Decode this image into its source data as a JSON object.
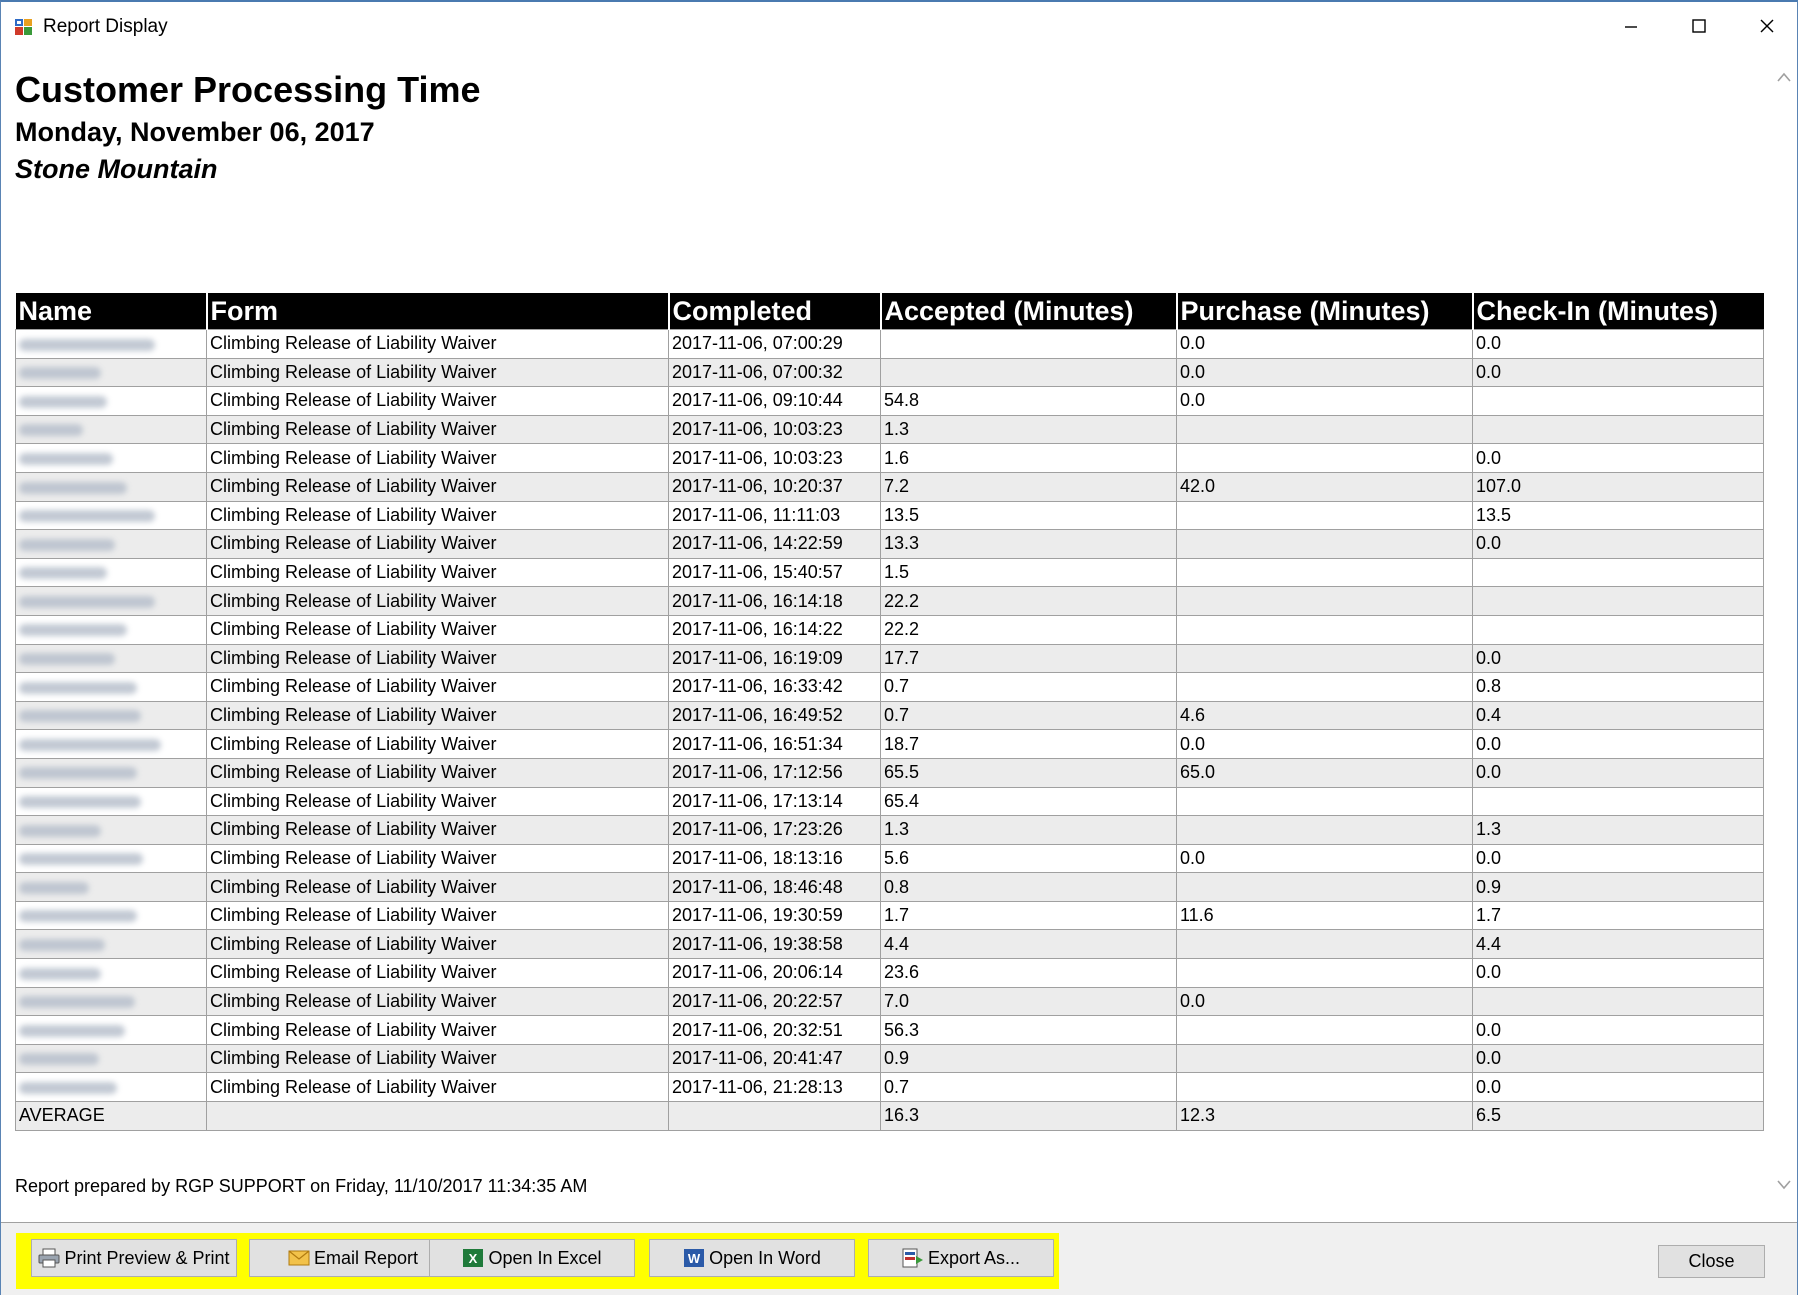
{
  "window": {
    "title": "Report Display",
    "app_icon": "report-app-icon",
    "controls": [
      "minimize-icon",
      "maximize-icon",
      "close-icon"
    ]
  },
  "report": {
    "title": "Customer Processing Time",
    "date": "Monday, November 06, 2017",
    "location": "Stone Mountain",
    "columns": [
      "Name",
      "Form",
      "Completed",
      "Accepted (Minutes)",
      "Purchase (Minutes)",
      "Check-In (Minutes)"
    ],
    "rows": [
      {
        "form": "Climbing Release of Liability Waiver",
        "completed": "2017-11-06, 07:00:29",
        "accepted": "",
        "purchase": "0.0",
        "checkin": "0.0"
      },
      {
        "form": "Climbing Release of Liability Waiver",
        "completed": "2017-11-06, 07:00:32",
        "accepted": "",
        "purchase": "0.0",
        "checkin": "0.0"
      },
      {
        "form": "Climbing Release of Liability Waiver",
        "completed": "2017-11-06, 09:10:44",
        "accepted": "54.8",
        "purchase": "0.0",
        "checkin": ""
      },
      {
        "form": "Climbing Release of Liability Waiver",
        "completed": "2017-11-06, 10:03:23",
        "accepted": "1.3",
        "purchase": "",
        "checkin": ""
      },
      {
        "form": "Climbing Release of Liability Waiver",
        "completed": "2017-11-06, 10:03:23",
        "accepted": "1.6",
        "purchase": "",
        "checkin": "0.0"
      },
      {
        "form": "Climbing Release of Liability Waiver",
        "completed": "2017-11-06, 10:20:37",
        "accepted": "7.2",
        "purchase": "42.0",
        "checkin": "107.0"
      },
      {
        "form": "Climbing Release of Liability Waiver",
        "completed": "2017-11-06, 11:11:03",
        "accepted": "13.5",
        "purchase": "",
        "checkin": "13.5"
      },
      {
        "form": "Climbing Release of Liability Waiver",
        "completed": "2017-11-06, 14:22:59",
        "accepted": "13.3",
        "purchase": "",
        "checkin": "0.0"
      },
      {
        "form": "Climbing Release of Liability Waiver",
        "completed": "2017-11-06, 15:40:57",
        "accepted": "1.5",
        "purchase": "",
        "checkin": ""
      },
      {
        "form": "Climbing Release of Liability Waiver",
        "completed": "2017-11-06, 16:14:18",
        "accepted": "22.2",
        "purchase": "",
        "checkin": ""
      },
      {
        "form": "Climbing Release of Liability Waiver",
        "completed": "2017-11-06, 16:14:22",
        "accepted": "22.2",
        "purchase": "",
        "checkin": ""
      },
      {
        "form": "Climbing Release of Liability Waiver",
        "completed": "2017-11-06, 16:19:09",
        "accepted": "17.7",
        "purchase": "",
        "checkin": "0.0"
      },
      {
        "form": "Climbing Release of Liability Waiver",
        "completed": "2017-11-06, 16:33:42",
        "accepted": "0.7",
        "purchase": "",
        "checkin": "0.8"
      },
      {
        "form": "Climbing Release of Liability Waiver",
        "completed": "2017-11-06, 16:49:52",
        "accepted": "0.7",
        "purchase": "4.6",
        "checkin": "0.4"
      },
      {
        "form": "Climbing Release of Liability Waiver",
        "completed": "2017-11-06, 16:51:34",
        "accepted": "18.7",
        "purchase": "0.0",
        "checkin": "0.0"
      },
      {
        "form": "Climbing Release of Liability Waiver",
        "completed": "2017-11-06, 17:12:56",
        "accepted": "65.5",
        "purchase": "65.0",
        "checkin": "0.0"
      },
      {
        "form": "Climbing Release of Liability Waiver",
        "completed": "2017-11-06, 17:13:14",
        "accepted": "65.4",
        "purchase": "",
        "checkin": ""
      },
      {
        "form": "Climbing Release of Liability Waiver",
        "completed": "2017-11-06, 17:23:26",
        "accepted": "1.3",
        "purchase": "",
        "checkin": "1.3"
      },
      {
        "form": "Climbing Release of Liability Waiver",
        "completed": "2017-11-06, 18:13:16",
        "accepted": "5.6",
        "purchase": "0.0",
        "checkin": "0.0"
      },
      {
        "form": "Climbing Release of Liability Waiver",
        "completed": "2017-11-06, 18:46:48",
        "accepted": "0.8",
        "purchase": "",
        "checkin": "0.9"
      },
      {
        "form": "Climbing Release of Liability Waiver",
        "completed": "2017-11-06, 19:30:59",
        "accepted": "1.7",
        "purchase": "11.6",
        "checkin": "1.7"
      },
      {
        "form": "Climbing Release of Liability Waiver",
        "completed": "2017-11-06, 19:38:58",
        "accepted": "4.4",
        "purchase": "",
        "checkin": "4.4"
      },
      {
        "form": "Climbing Release of Liability Waiver",
        "completed": "2017-11-06, 20:06:14",
        "accepted": "23.6",
        "purchase": "",
        "checkin": "0.0"
      },
      {
        "form": "Climbing Release of Liability Waiver",
        "completed": "2017-11-06, 20:22:57",
        "accepted": "7.0",
        "purchase": "0.0",
        "checkin": ""
      },
      {
        "form": "Climbing Release of Liability Waiver",
        "completed": "2017-11-06, 20:32:51",
        "accepted": "56.3",
        "purchase": "",
        "checkin": "0.0"
      },
      {
        "form": "Climbing Release of Liability Waiver",
        "completed": "2017-11-06, 20:41:47",
        "accepted": "0.9",
        "purchase": "",
        "checkin": "0.0"
      },
      {
        "form": "Climbing Release of Liability Waiver",
        "completed": "2017-11-06, 21:28:13",
        "accepted": "0.7",
        "purchase": "",
        "checkin": "0.0"
      }
    ],
    "average": {
      "label": "AVERAGE",
      "accepted": "16.3",
      "purchase": "12.3",
      "checkin": "6.5"
    },
    "footer": "Report prepared by RGP SUPPORT on Friday, 11/10/2017 11:34:35 AM"
  },
  "toolbar": {
    "highlight_color": "#ffff00",
    "buttons": [
      {
        "label": "Print Preview & Print",
        "icon": "printer-icon"
      },
      {
        "label": "Email Report",
        "icon": "envelope-icon"
      },
      {
        "label": "Open In Excel",
        "icon": "excel-icon"
      },
      {
        "label": "Open In Word",
        "icon": "word-icon"
      },
      {
        "label": "Export As...",
        "icon": "export-icon"
      }
    ],
    "close_label": "Close"
  }
}
